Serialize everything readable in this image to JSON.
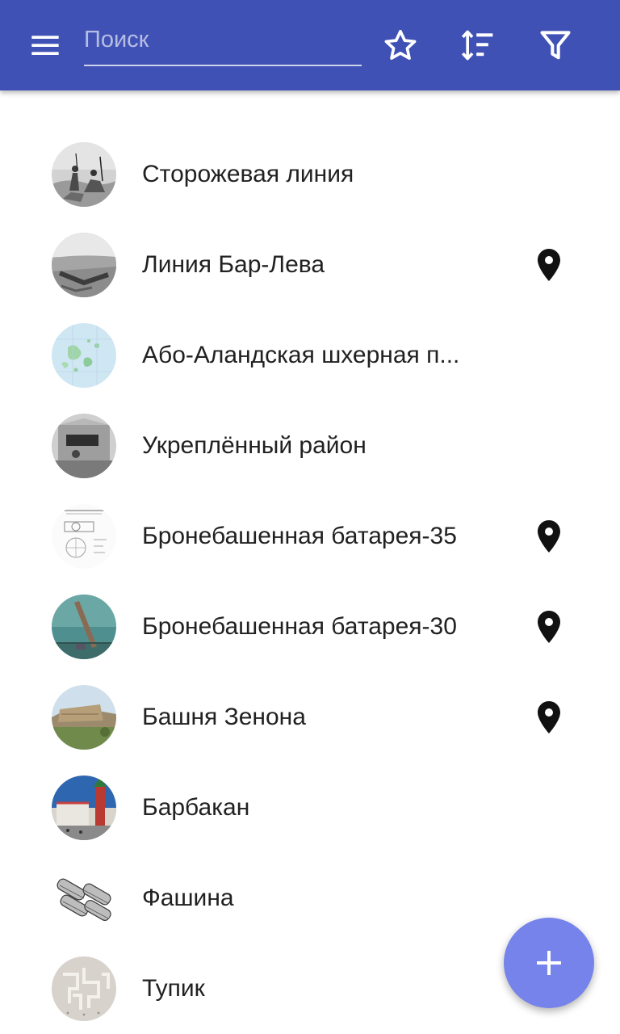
{
  "colors": {
    "app_bar": "#3f51b5",
    "fab": "#7583ea",
    "text_primary": "#212121",
    "pin": "#111111"
  },
  "toolbar": {
    "menu_icon": "menu-icon",
    "search_placeholder": "Поиск",
    "search_value": "",
    "favorite_icon": "star-outline-icon",
    "sort_icon": "sort-icon",
    "filter_icon": "filter-icon"
  },
  "items": [
    {
      "title": "Сторожевая линия",
      "has_location": false,
      "thumb": "engraving-riders"
    },
    {
      "title": "Линия Бар-Лева",
      "has_location": true,
      "thumb": "desert-trench"
    },
    {
      "title": "Або-Аландская шхерная п...",
      "has_location": false,
      "thumb": "map-islands"
    },
    {
      "title": "Укреплённый район",
      "has_location": false,
      "thumb": "bunker-photo"
    },
    {
      "title": "Бронебашенная батарея-35",
      "has_location": true,
      "thumb": "schematic-drawing"
    },
    {
      "title": "Бронебашенная батарея-30",
      "has_location": true,
      "thumb": "gun-barrel-sky"
    },
    {
      "title": "Башня Зенона",
      "has_location": true,
      "thumb": "ruined-tower"
    },
    {
      "title": "Барбакан",
      "has_location": false,
      "thumb": "kremlin-tower"
    },
    {
      "title": "Фашина",
      "has_location": false,
      "thumb": "fascine-bundles"
    },
    {
      "title": "Тупик",
      "has_location": false,
      "thumb": "maze-pattern"
    }
  ],
  "fab": {
    "icon": "plus-icon"
  }
}
